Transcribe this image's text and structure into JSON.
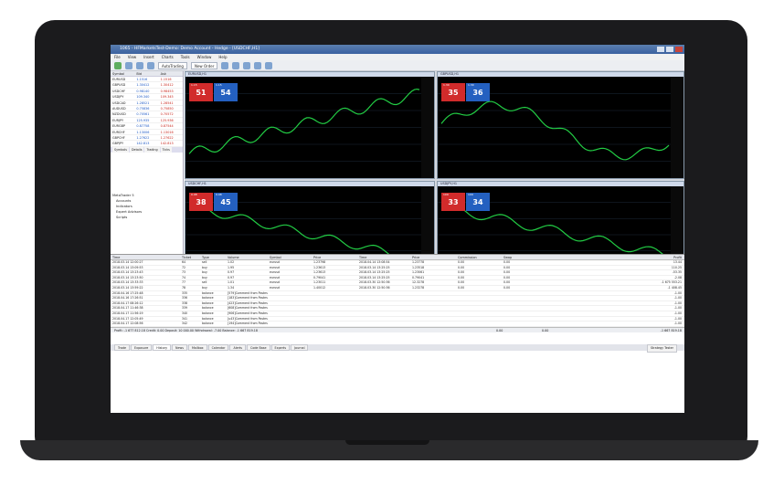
{
  "window": {
    "title": "1065 - HFMarketsTest-Demo: Demo Account - Hedge - [USDCHF,H1]"
  },
  "menu": [
    "File",
    "View",
    "Insert",
    "Charts",
    "Tools",
    "Window",
    "Help"
  ],
  "toolbar": {
    "autotrading": "AutoTrading",
    "new_order": "New Order"
  },
  "market_watch": {
    "headers": [
      "Symbol",
      "Bid",
      "Ask"
    ],
    "rows": [
      {
        "symbol": "EURUSD",
        "bid": "1.1516",
        "ask": "1.1516"
      },
      {
        "symbol": "GBPUSD",
        "bid": "1.30412",
        "ask": "1.30412"
      },
      {
        "symbol": "USDCHF",
        "bid": "0.98140",
        "ask": "0.98453"
      },
      {
        "symbol": "USDJPY",
        "bid": "109.340",
        "ask": "109.345"
      },
      {
        "symbol": "USDCAD",
        "bid": "1.28521",
        "ask": "1.28541"
      },
      {
        "symbol": "AUDUSD",
        "bid": "0.75836",
        "ask": "0.75850"
      },
      {
        "symbol": "NZDUSD",
        "bid": "0.70561",
        "ask": "0.70572"
      },
      {
        "symbol": "EURJPY",
        "bid": "125.935",
        "ask": "125.936"
      },
      {
        "symbol": "EURGBP",
        "bid": "0.87758",
        "ask": "0.87544"
      },
      {
        "symbol": "EURCHF",
        "bid": "1.13006",
        "ask": "1.13016"
      },
      {
        "symbol": "GBPCHF",
        "bid": "1.27622",
        "ask": "1.27622"
      },
      {
        "symbol": "GBPJPY",
        "bid": "142.813",
        "ask": "142.813"
      }
    ],
    "tabs": [
      "Symbols",
      "Details",
      "Trading",
      "Ticks"
    ]
  },
  "navigator": {
    "root": "MetaTrader 5",
    "items": [
      "Accounts",
      "Indicators",
      "Expert Advisors",
      "Scripts"
    ],
    "tabs": [
      "Common",
      "Favorites"
    ]
  },
  "charts": [
    {
      "title": "EURUSD,H1",
      "sell": "51",
      "buy": "54",
      "sell_pre": "1.15",
      "buy_pre": "1.15",
      "color": "#22cc44"
    },
    {
      "title": "GBPUSD,H1",
      "sell": "35",
      "buy": "36",
      "sell_pre": "1.30",
      "buy_pre": "1.30",
      "color": "#22cc44"
    },
    {
      "title": "USDCHF,H1",
      "sell": "38",
      "buy": "45",
      "sell_pre": "0.98",
      "buy_pre": "0.98",
      "color": "#22cc44"
    },
    {
      "title": "USDJPY,H1",
      "sell": "33",
      "buy": "34",
      "sell_pre": "109",
      "buy_pre": "109",
      "color": "#22cc44"
    }
  ],
  "chart_tabs": [
    "EURUSD,H1",
    "USDCHF,H1",
    "GBPUSD,H1",
    "USDJPY,H1"
  ],
  "terminal": {
    "headers": [
      "Time",
      "Ticket",
      "Type",
      "Volume",
      "Symbol",
      "Price",
      "Time",
      "Price",
      "Commission",
      "Swap",
      "Profit"
    ],
    "rows": [
      [
        "2018.03.14 12:00:27",
        "64",
        "sell",
        "1.02",
        "eurusd",
        "1.23798",
        "2018.04.14 13:08:54",
        "1.23778",
        "0.00",
        "0.00",
        "13.44"
      ],
      [
        "2018.03.14 13:09:53",
        "72",
        "buy",
        "1.95",
        "eurusd",
        "1.23613",
        "2018.03.14 13:25:25",
        "1.23518",
        "0.00",
        "0.00",
        "110.25"
      ],
      [
        "2018.03.14 13:23:43",
        "73",
        "buy",
        "0.97",
        "eurusd",
        "1.23613",
        "2018.03.14 13:25:25",
        "1.23061",
        "0.00",
        "0.00",
        "-53.35"
      ],
      [
        "2018.03.14 13:23:50",
        "74",
        "buy",
        "0.97",
        "eurusd",
        "0.79041",
        "2018.03.14 13:25:25",
        "0.79041",
        "0.00",
        "0.00",
        "-2.08"
      ],
      [
        "2018.03.14 13:33:33",
        "77",
        "sell",
        "1.01",
        "eurusd",
        "1.23011",
        "2018.03.30 12:50:36",
        "12.3278",
        "0.00",
        "0.00",
        "-1 675 553.21"
      ],
      [
        "2018.03.14 13:59:22",
        "78",
        "buy",
        "1.34",
        "eurusd",
        "1.40012",
        "2018.03.30 12:50:36",
        "1.23278",
        "0.00",
        "0.00",
        "-1 408.45"
      ],
      [
        "2018.04.16 17:25:48",
        "335",
        "balance",
        "[579]Comment from Postman",
        "",
        "",
        "",
        "",
        "",
        "",
        "-1.00"
      ],
      [
        "2018.04.16 17:26:51",
        "336",
        "balance",
        "[183]Comment from Postman",
        "",
        "",
        "",
        "",
        "",
        "",
        "-1.00"
      ],
      [
        "2018.04.17 08:26:12",
        "338",
        "balance",
        "[423]Comment from Postman",
        "",
        "",
        "",
        "",
        "",
        "",
        "-1.00"
      ],
      [
        "2018.04.17 11:46:38",
        "339",
        "balance",
        "[608]Comment from Postman",
        "",
        "",
        "",
        "",
        "",
        "",
        "-1.00"
      ],
      [
        "2018.04.17 11:56:19",
        "340",
        "balance",
        "[906]Comment from Postman",
        "",
        "",
        "",
        "",
        "",
        "",
        "-1.00"
      ],
      [
        "2018.04.17 12:05:49",
        "341",
        "balance",
        "[u43]Comment from Postman",
        "",
        "",
        "",
        "",
        "",
        "",
        "-1.00"
      ],
      [
        "2018.04.17 12:08:56",
        "342",
        "balance",
        "[194]Comment from Postman",
        "",
        "",
        "",
        "",
        "",
        "",
        "-1.00"
      ]
    ],
    "balance_line": "Profit: -1 677 812.18  Credit: 0.00  Deposit: 10 000.00  Withdrawal: -7.00  Balance: -1 667 819.18",
    "balance_right": [
      "0.00",
      "0.00",
      "-1 667 819.18"
    ],
    "tabs": [
      "Trade",
      "Exposure",
      "History",
      "News",
      "Mailbox",
      "Calendar",
      "Alerts",
      "Code Base",
      "Experts",
      "Journal"
    ],
    "active_tab": "History",
    "strategy_tester": "Strategy Tester"
  }
}
